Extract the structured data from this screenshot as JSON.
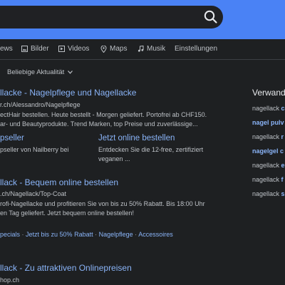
{
  "search": {
    "query": ""
  },
  "nav": {
    "items": [
      {
        "label": "ews",
        "icon": "news-icon"
      },
      {
        "label": "Bilder",
        "icon": "image-icon"
      },
      {
        "label": "Videos",
        "icon": "video-icon"
      },
      {
        "label": "Maps",
        "icon": "map-pin-icon"
      },
      {
        "label": "Musik",
        "icon": "music-note-icon"
      },
      {
        "label": "Einstellungen",
        "icon": ""
      }
    ]
  },
  "filters": {
    "recency": "Beliebige Aktualität"
  },
  "results": [
    {
      "title": "llacke - Nagelpflege und Nagellacke",
      "url": "r.ch/Alessandro/Nagelpflege",
      "snippet": [
        "ectHair bestellen. Heute bestellt - Morgen geliefert. Portofrei ab CHF150.",
        "ar- und Beautyprodukte. Trend Marken, top Preise und zuverlässige..."
      ],
      "sitelinks": [
        {
          "title": "pseller",
          "desc": [
            "pseller von Nailberry bei"
          ]
        },
        {
          "title": "Jetzt online bestellen",
          "desc": [
            "Entdecken Sie die 12-free, zertifiziert",
            "veganen ..."
          ]
        }
      ]
    },
    {
      "title": "llack - Bequem online bestellen",
      "url": ".ch/Nagellack/Top-Coat",
      "snippet": [
        "rofi-Nagellacke und profitieren Sie von bis zu 50% Rabatt. Bis 18:00 Uhr",
        "en Tag geliefert. Jetzt bequem online bestellen!"
      ],
      "links": [
        "pecials",
        "Jetzt bis zu 50% Rabatt",
        "Nagelpflege",
        "Accessoires"
      ]
    },
    {
      "title": "llack - Zu attraktiven Onlinepreisen",
      "url": "hop.ch"
    }
  ],
  "related": {
    "title": "Verwand",
    "items": [
      {
        "text": "nagellack ",
        "bold": "c"
      },
      {
        "text": "nagel pu",
        "bold": "lv"
      },
      {
        "text": "nagellack ",
        "bold": "r"
      },
      {
        "text": "nagelgel c",
        "bold": ""
      },
      {
        "text": "nagellack ",
        "bold": "e"
      },
      {
        "text": "nagellack ",
        "bold": "f"
      },
      {
        "text": "nagellack ",
        "bold": "s"
      }
    ]
  },
  "colors": {
    "accent": "#4a82f5",
    "link": "#8ab4f8",
    "url": "#bdc1c6",
    "bg": "#1e2022"
  }
}
